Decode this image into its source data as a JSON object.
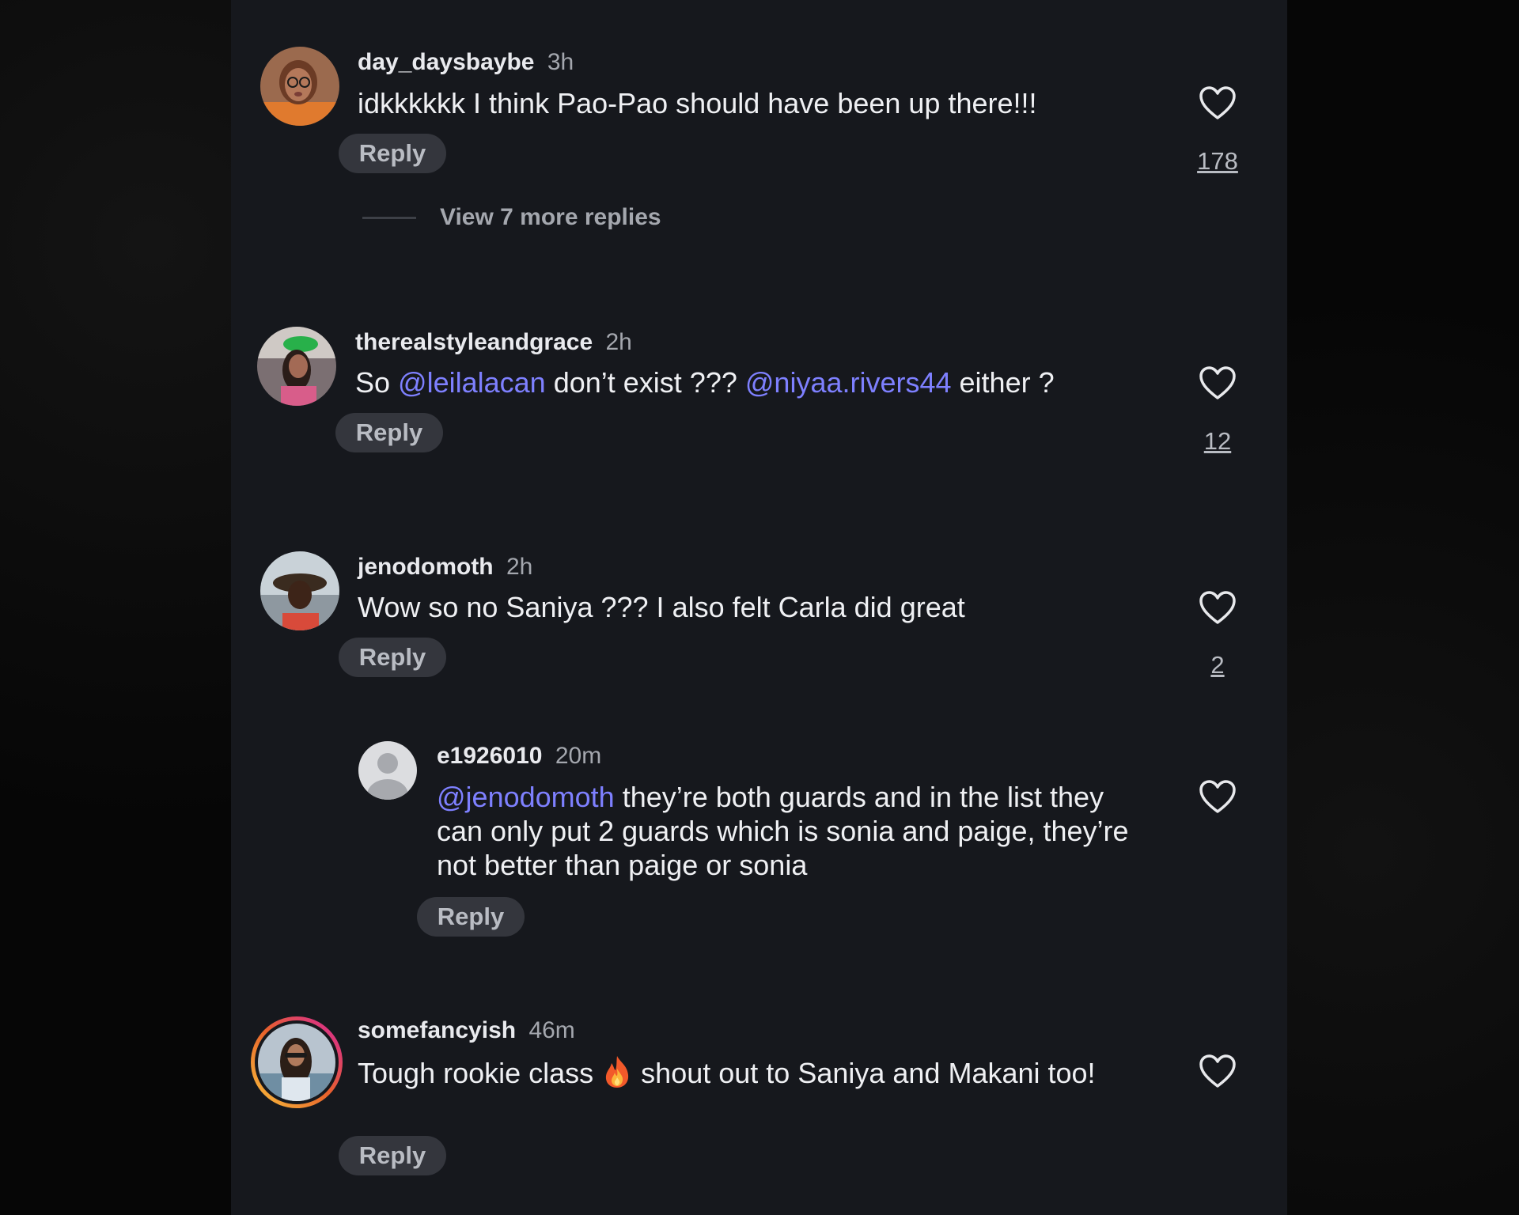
{
  "comments": [
    {
      "username": "day_daysbaybe",
      "time": "3h",
      "text": "idkkkkkk I think Pao-Pao should have been up there!!!",
      "reply_label": "Reply",
      "likes": "178",
      "view_more": "View 7 more replies"
    },
    {
      "username": "therealstyleandgrace",
      "time": "2h",
      "text_parts": [
        "So ",
        "@leilalacan",
        " don’t exist ??? ",
        "@niyaa.rivers44",
        " either ?"
      ],
      "reply_label": "Reply",
      "likes": "12"
    },
    {
      "username": "jenodomoth",
      "time": "2h",
      "text": "Wow so no Saniya ??? I also felt Carla did great",
      "reply_label": "Reply",
      "likes": "2",
      "replies": [
        {
          "username": "e1926010",
          "time": "20m",
          "mention": "@jenodomoth",
          "text": " they’re both guards and in the list they can only put 2 guards which is sonia and paige, they’re not better than paige or sonia",
          "reply_label": "Reply"
        }
      ]
    },
    {
      "username": "somefancyish",
      "time": "46m",
      "text_before": "Tough rookie class",
      "emoji": "fire-icon",
      "text_after": "shout out to Saniya and Makani too!",
      "reply_label": "Reply"
    }
  ],
  "colors": {
    "background": "#060606",
    "panel": "#16181d",
    "mention": "#7e80ff",
    "story_ring_start": "#f9c23c",
    "story_ring_end": "#d6249f"
  }
}
